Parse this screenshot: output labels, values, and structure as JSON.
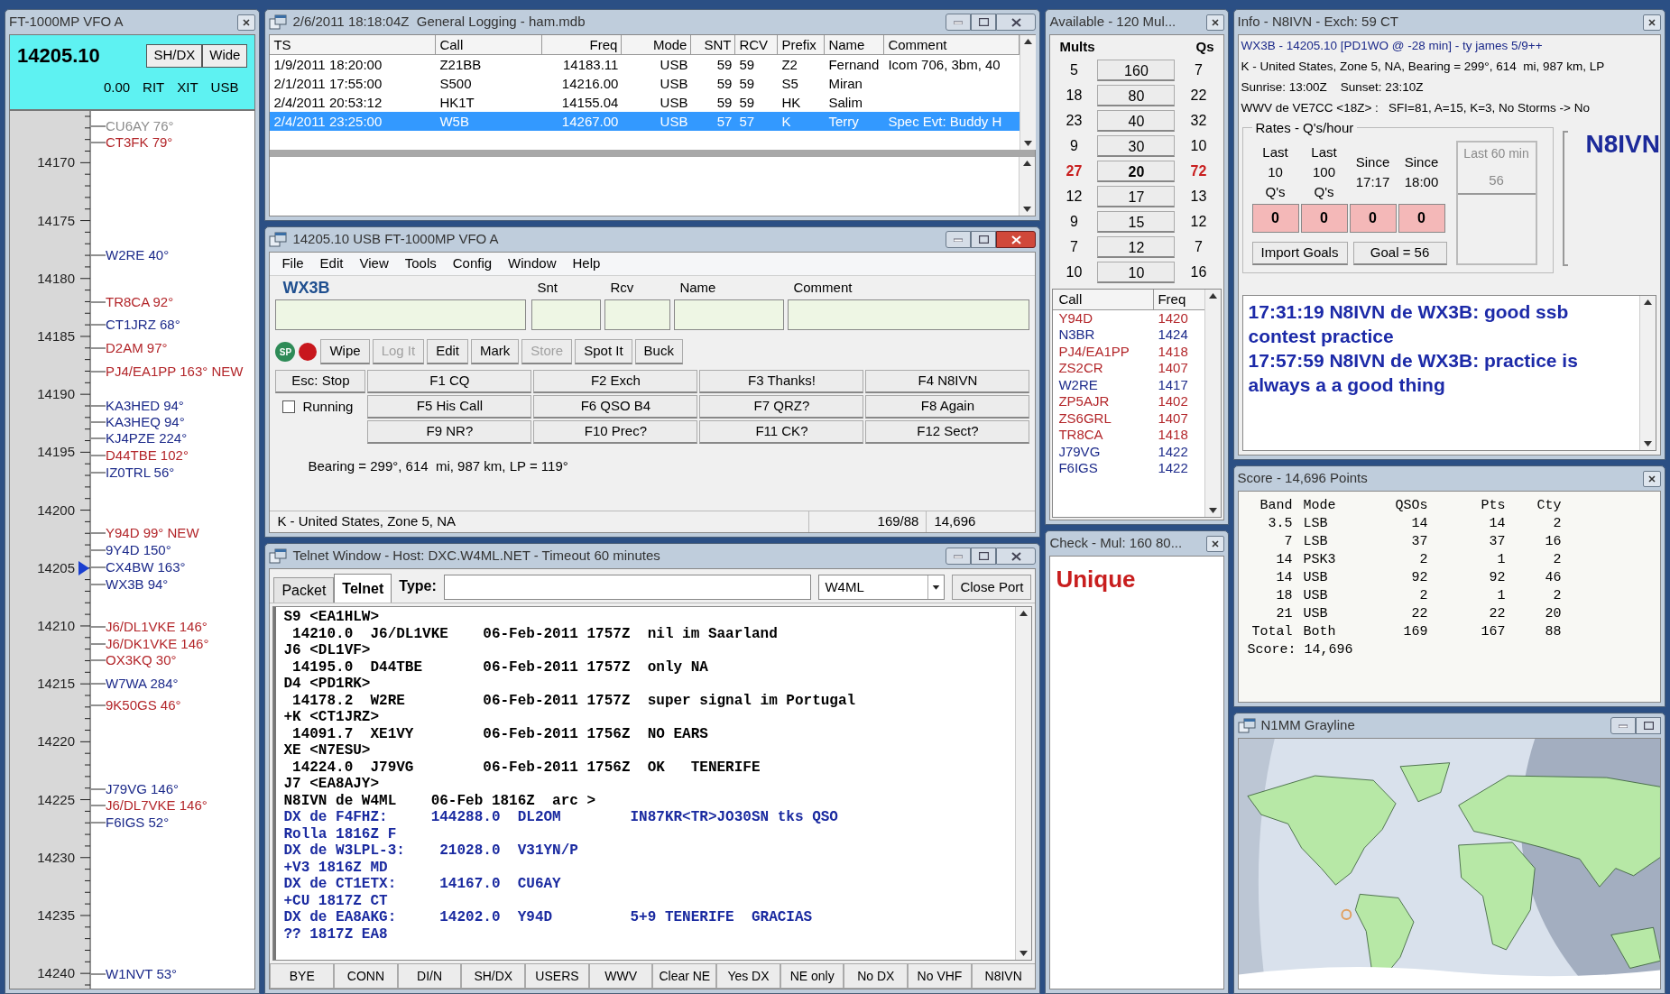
{
  "band_map": {
    "title": "FT-1000MP VFO A",
    "frequency": "14205.10",
    "buttons": [
      "SH/DX",
      "Wide"
    ],
    "status": [
      "0.00",
      "RIT",
      "XIT",
      "USB"
    ],
    "ticks": [
      "14170",
      "14175",
      "14180",
      "14185",
      "14190",
      "14195",
      "14200",
      "14205",
      "14210",
      "14215",
      "14220",
      "14225",
      "14230",
      "14235",
      "14240"
    ],
    "spots": [
      {
        "text": "CU6AY 76°",
        "color": "#8c8c8c"
      },
      {
        "text": "CT3FK 79°",
        "color": "#b3262a"
      },
      {
        "text": "W2RE 40°",
        "color": "#1c2a8a"
      },
      {
        "text": "TR8CA 92°",
        "color": "#b3262a"
      },
      {
        "text": "CT1JRZ 68°",
        "color": "#1c2a8a"
      },
      {
        "text": "D2AM 97°",
        "color": "#b3262a"
      },
      {
        "text": "PJ4/EA1PP 163° NEW",
        "color": "#b3262a"
      },
      {
        "text": "KA3HED 94°",
        "color": "#1c2a8a"
      },
      {
        "text": "KA3HEQ 94°",
        "color": "#1c2a8a"
      },
      {
        "text": "KJ4PZE 224°",
        "color": "#1c2a8a"
      },
      {
        "text": "D44TBE 102°",
        "color": "#b3262a"
      },
      {
        "text": "IZ0TRL 56°",
        "color": "#1c2a8a"
      },
      {
        "text": "Y94D 99° NEW",
        "color": "#b3262a"
      },
      {
        "text": "9Y4D 150°",
        "color": "#1c2a8a"
      },
      {
        "text": "CX4BW 163°",
        "color": "#1c2a8a"
      },
      {
        "text": "WX3B 94°",
        "color": "#1c2a8a"
      },
      {
        "text": "J6/DL1VKE 146°",
        "color": "#b3262a"
      },
      {
        "text": "J6/DK1VKE 146°",
        "color": "#b3262a"
      },
      {
        "text": "OX3KQ 30°",
        "color": "#b3262a"
      },
      {
        "text": "W7WA 284°",
        "color": "#1c2a8a"
      },
      {
        "text": "9K50GS 46°",
        "color": "#b3262a"
      },
      {
        "text": "J79VG 146°",
        "color": "#1c2a8a"
      },
      {
        "text": "J6/DL7VKE 146°",
        "color": "#b3262a"
      },
      {
        "text": "F6IGS 52°",
        "color": "#1c2a8a"
      },
      {
        "text": "W1NVT 53°",
        "color": "#1c2a8a"
      }
    ]
  },
  "log_window": {
    "title": "2/6/2011 18:18:04Z  General Logging - ham.mdb",
    "columns": [
      "TS",
      "Call",
      "Freq",
      "Mode",
      "SNT",
      "RCV",
      "Prefix",
      "Name",
      "Comment"
    ],
    "rows": [
      {
        "cells": [
          "1/9/2011 18:20:00",
          "Z21BB",
          "14183.11",
          "USB",
          "59",
          "59",
          "Z2",
          "Fernand",
          "Icom 706, 3bm, 40"
        ],
        "selected": false
      },
      {
        "cells": [
          "2/1/2011 17:55:00",
          "S500",
          "14216.00",
          "USB",
          "59",
          "59",
          "S5",
          "Miran",
          ""
        ],
        "selected": false
      },
      {
        "cells": [
          "2/4/2011 20:53:12",
          "HK1T",
          "14155.04",
          "USB",
          "59",
          "59",
          "HK",
          "Salim",
          ""
        ],
        "selected": false
      },
      {
        "cells": [
          "2/4/2011 23:25:00",
          "W5B",
          "14267.00",
          "USB",
          "57",
          "57",
          "K",
          "Terry",
          "Spec Evt: Buddy H"
        ],
        "selected": true
      }
    ]
  },
  "entry_window": {
    "title": "14205.10 USB FT-1000MP VFO A",
    "menu": [
      "File",
      "Edit",
      "View",
      "Tools",
      "Config",
      "Window",
      "Help"
    ],
    "call_label": "WX3B",
    "field_labels": [
      "Snt",
      "Rcv",
      "Name",
      "Comment"
    ],
    "sp_badge": "SP",
    "buttons": [
      {
        "label": "Wipe",
        "disabled": false
      },
      {
        "label": "Log It",
        "disabled": true
      },
      {
        "label": "Edit",
        "disabled": false
      },
      {
        "label": "Mark",
        "disabled": false
      },
      {
        "label": "Store",
        "disabled": true
      },
      {
        "label": "Spot It",
        "disabled": false
      },
      {
        "label": "Buck",
        "disabled": false
      }
    ],
    "esc_button": "Esc: Stop",
    "running": {
      "label": "Running",
      "checked": false
    },
    "function_keys": [
      "F1 CQ",
      "F2 Exch",
      "F3 Thanks!",
      "F4 N8IVN",
      "F5 His Call",
      "F6 QSO B4",
      "F7 QRZ?",
      "F8 Again",
      "F9 NR?",
      "F10 Prec?",
      "F11 CK?",
      "F12 Sect?"
    ],
    "bearing": "Bearing = 299°, 614  mi, 987 km, LP = 119°",
    "status": [
      "K - United States, Zone 5, NA",
      "169/88",
      "14,696"
    ]
  },
  "telnet_window": {
    "title": "Telnet Window - Host: DXC.W4ML.NET - Timeout 60 minutes",
    "tabs": [
      {
        "label": "Packet",
        "selected": false
      },
      {
        "label": "Telnet",
        "selected": true
      }
    ],
    "type_label": "Type:",
    "node": "W4ML",
    "close_button": "Close Port",
    "lines": [
      {
        "text": "S9 <EA1HLW>",
        "color": "#000000"
      },
      {
        "text": " 14210.0  J6/DL1VKE    06-Feb-2011 1757Z  nil im Saarland",
        "color": "#000000"
      },
      {
        "text": "J6 <DL1VF>",
        "color": "#000000"
      },
      {
        "text": " 14195.0  D44TBE       06-Feb-2011 1757Z  only NA",
        "color": "#000000"
      },
      {
        "text": "D4 <PD1RK>",
        "color": "#000000"
      },
      {
        "text": " 14178.2  W2RE         06-Feb-2011 1757Z  super signal im Portugal",
        "color": "#000000"
      },
      {
        "text": "+K <CT1JRZ>",
        "color": "#000000"
      },
      {
        "text": " 14091.7  XE1VY        06-Feb-2011 1756Z  NO EARS",
        "color": "#000000"
      },
      {
        "text": "XE <N7ESU>",
        "color": "#000000"
      },
      {
        "text": " 14224.0  J79VG        06-Feb-2011 1756Z  OK   TENERIFE",
        "color": "#000000"
      },
      {
        "text": "J7 <EA8AJY>",
        "color": "#000000"
      },
      {
        "text": "N8IVN de W4ML    06-Feb 1816Z  arc >",
        "color": "#000000"
      },
      {
        "text": "DX de F4FHZ:     144288.0  DL2OM        IN87KR<TR>JO30SN tks QSO",
        "color": "#1a2aa0"
      },
      {
        "text": "Rolla 1816Z F",
        "color": "#1a2aa0"
      },
      {
        "text": "DX de W3LPL-3:    21028.0  V31YN/P",
        "color": "#1a2aa0"
      },
      {
        "text": "+V3 1816Z MD",
        "color": "#1a2aa0"
      },
      {
        "text": "DX de CT1ETX:     14167.0  CU6AY",
        "color": "#1a2aa0"
      },
      {
        "text": "+CU 1817Z CT",
        "color": "#1a2aa0"
      },
      {
        "text": "DX de EA8AKG:     14202.0  Y94D         5+9 TENERIFE  GRACIAS",
        "color": "#1a2aa0"
      },
      {
        "text": "?? 1817Z EA8",
        "color": "#1a2aa0"
      }
    ],
    "buttons": [
      "BYE",
      "CONN",
      "DI/N",
      "SH/DX",
      "USERS",
      "WWV",
      "Clear NE",
      "Yes DX",
      "NE only",
      "No DX",
      "No VHF",
      "N8IVN"
    ]
  },
  "available_window": {
    "title": "Available - 120 Mul...",
    "headers": [
      "Mults",
      "Qs"
    ],
    "bands": [
      {
        "mults": "5",
        "band": "160",
        "qs": "7",
        "selected": false
      },
      {
        "mults": "18",
        "band": "80",
        "qs": "22",
        "selected": false
      },
      {
        "mults": "23",
        "band": "40",
        "qs": "32",
        "selected": false
      },
      {
        "mults": "9",
        "band": "30",
        "qs": "10",
        "selected": false
      },
      {
        "mults": "27",
        "band": "20",
        "qs": "72",
        "selected": true
      },
      {
        "mults": "12",
        "band": "17",
        "qs": "13",
        "selected": false
      },
      {
        "mults": "9",
        "band": "15",
        "qs": "12",
        "selected": false
      },
      {
        "mults": "7",
        "band": "12",
        "qs": "7",
        "selected": false
      },
      {
        "mults": "10",
        "band": "10",
        "qs": "16",
        "selected": false
      }
    ],
    "list_columns": [
      "Call",
      "Freq"
    ],
    "list": [
      {
        "call": "Y94D",
        "freq": "1420",
        "color": "#b3262a"
      },
      {
        "call": "N3BR",
        "freq": "1424",
        "color": "#1c2a8a"
      },
      {
        "call": "PJ4/EA1PP",
        "freq": "1418",
        "color": "#b3262a"
      },
      {
        "call": "ZS2CR",
        "freq": "1407",
        "color": "#b3262a"
      },
      {
        "call": "W2RE",
        "freq": "1417",
        "color": "#1c2a8a"
      },
      {
        "call": "ZP5AJR",
        "freq": "1402",
        "color": "#b3262a"
      },
      {
        "call": "ZS6GRL",
        "freq": "1407",
        "color": "#b3262a"
      },
      {
        "call": "TR8CA",
        "freq": "1418",
        "color": "#b3262a"
      },
      {
        "call": "J79VG",
        "freq": "1422",
        "color": "#1c2a8a"
      },
      {
        "call": "F6IGS",
        "freq": "1422",
        "color": "#1c2a8a"
      }
    ]
  },
  "check_window": {
    "title": "Check - Mul: 160 80...",
    "result": "Unique"
  },
  "info_window": {
    "title": "Info - N8IVN - Exch: 59 CT",
    "lines": [
      {
        "text": "WX3B - 14205.10 [PD1WO @ -28 min] - ty james 5/9++",
        "color": "#1c2a8a"
      },
      {
        "text": "K - United States, Zone 5, NA, Bearing = 299°, 614  mi, 987 km, LP",
        "color": "#000000"
      },
      {
        "text": "Sunrise: 13:00Z    Sunset: 23:10Z",
        "color": "#000000"
      },
      {
        "text": "WWV de VE7CC <18Z> :   SFI=81, A=15, K=3, No Storms -> No",
        "color": "#000000"
      }
    ],
    "rates": {
      "title": "Rates - Q's/hour",
      "columns": [
        {
          "header": "Last 10 Q's",
          "value": "0"
        },
        {
          "header": "Last 100 Q's",
          "value": "0"
        },
        {
          "header": "Since 17:17",
          "value": "0"
        },
        {
          "header": "Since 18:00",
          "value": "0"
        }
      ],
      "last60_label": "Last 60 min",
      "last60_value": "56",
      "buttons": [
        "Import Goals",
        "Goal = 56"
      ]
    },
    "callsign": "N8IVN",
    "messages": [
      "17:31:19 N8IVN de WX3B: good ssb contest practice",
      "17:57:59 N8IVN de WX3B: practice is always a a good thing"
    ]
  },
  "score_window": {
    "title": "Score - 14,696 Points",
    "columns": [
      "Band",
      "Mode",
      "QSOs",
      "Pts",
      "Cty"
    ],
    "rows": [
      [
        "3.5",
        "LSB",
        "14",
        "14",
        "2"
      ],
      [
        "7",
        "LSB",
        "37",
        "37",
        "16"
      ],
      [
        "14",
        "PSK3",
        "2",
        "1",
        "2"
      ],
      [
        "14",
        "USB",
        "92",
        "92",
        "46"
      ],
      [
        "18",
        "USB",
        "2",
        "1",
        "2"
      ],
      [
        "21",
        "USB",
        "22",
        "22",
        "20"
      ],
      [
        "Total",
        "Both",
        "169",
        "167",
        "88"
      ]
    ],
    "score": "Score: 14,696"
  },
  "grayline_window": {
    "title": "N1MM Grayline"
  }
}
